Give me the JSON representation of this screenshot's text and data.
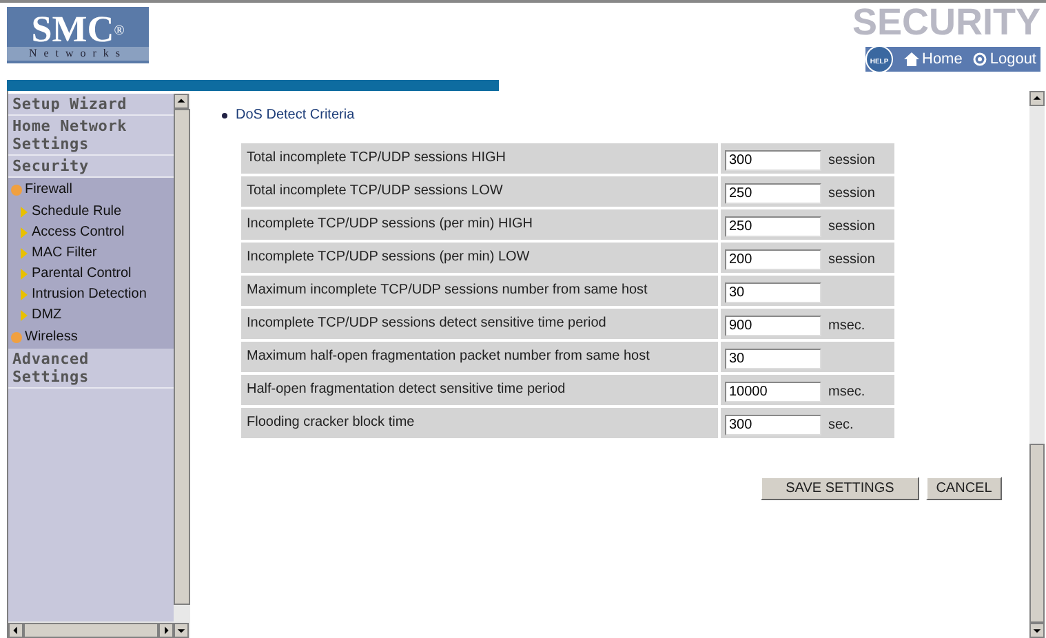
{
  "logo": {
    "name": "SMC",
    "mark": "®",
    "sub": "Networks"
  },
  "header": {
    "title": "SECURITY",
    "help": "HELP",
    "links": [
      "Home",
      "Logout"
    ]
  },
  "sidebar": {
    "items": [
      {
        "label": "Setup Wizard",
        "kind": "section"
      },
      {
        "label": "Home Network Settings",
        "kind": "section"
      },
      {
        "label": "Security",
        "kind": "section"
      },
      {
        "label": "Firewall",
        "kind": "group",
        "children": [
          {
            "label": "Schedule Rule"
          },
          {
            "label": "Access Control"
          },
          {
            "label": "MAC Filter"
          },
          {
            "label": "Parental Control"
          },
          {
            "label": "Intrusion Detection"
          },
          {
            "label": "DMZ"
          }
        ]
      },
      {
        "label": "Wireless",
        "kind": "group"
      },
      {
        "label": "Advanced Settings",
        "kind": "section"
      }
    ]
  },
  "heading": "DoS Detect Criteria",
  "rows": [
    {
      "label": "Total incomplete TCP/UDP sessions HIGH",
      "value": "300",
      "unit": "session"
    },
    {
      "label": "Total incomplete TCP/UDP sessions LOW",
      "value": "250",
      "unit": "session"
    },
    {
      "label": "Incomplete TCP/UDP sessions (per min) HIGH",
      "value": "250",
      "unit": "session"
    },
    {
      "label": "Incomplete TCP/UDP sessions (per min) LOW",
      "value": "200",
      "unit": "session"
    },
    {
      "label": "Maximum incomplete TCP/UDP sessions number from same host",
      "value": "30"
    },
    {
      "label": "Incomplete TCP/UDP sessions detect sensitive time period",
      "value": "900",
      "unit": "msec."
    },
    {
      "label": "Maximum half-open fragmentation packet number from same host",
      "value": "30"
    },
    {
      "label": "Half-open fragmentation detect sensitive time period",
      "value": "10000",
      "unit": "msec."
    },
    {
      "label": "Flooding cracker block time",
      "value": "300",
      "unit": "sec."
    }
  ],
  "buttons": [
    "SAVE SETTINGS",
    "CANCEL"
  ]
}
